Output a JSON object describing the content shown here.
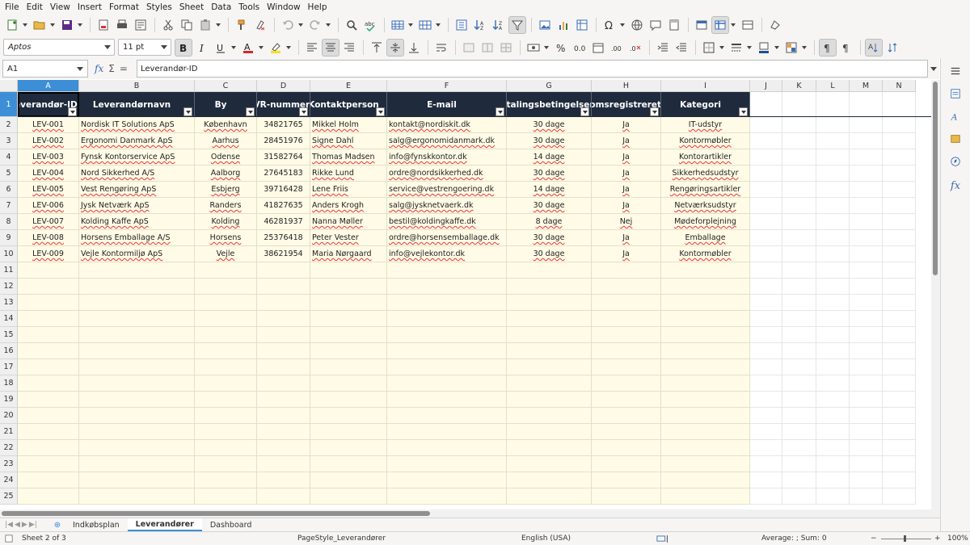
{
  "menu": [
    "File",
    "Edit",
    "View",
    "Insert",
    "Format",
    "Styles",
    "Sheet",
    "Data",
    "Tools",
    "Window",
    "Help"
  ],
  "format": {
    "font_name": "Aptos",
    "font_size": "11 pt"
  },
  "formula_bar": {
    "cell_ref": "A1",
    "content": "Leverandør-ID"
  },
  "columns": [
    "A",
    "B",
    "C",
    "D",
    "E",
    "F",
    "G",
    "H",
    "I",
    "J",
    "K",
    "L",
    "M",
    "N"
  ],
  "headers": [
    "Leverandør-ID",
    "Leverandørnavn",
    "By",
    "CVR-nummer",
    "Kontaktperson",
    "E-mail",
    "Betalingsbetingelser",
    "Momsregistreret",
    "Kategori"
  ],
  "rows": [
    [
      "LEV-001",
      "Nordisk IT Solutions ApS",
      "København",
      "34821765",
      "Mikkel Holm",
      "kontakt@nordiskit.dk",
      "30 dage",
      "Ja",
      "IT-udstyr"
    ],
    [
      "LEV-002",
      "Ergonomi Danmark ApS",
      "Aarhus",
      "28451976",
      "Signe Dahl",
      "salg@ergonomidanmark.dk",
      "30 dage",
      "Ja",
      "Kontormøbler"
    ],
    [
      "LEV-003",
      "Fynsk Kontorservice ApS",
      "Odense",
      "31582764",
      "Thomas Madsen",
      "info@fynskkontor.dk",
      "14 dage",
      "Ja",
      "Kontorartikler"
    ],
    [
      "LEV-004",
      "Nord Sikkerhed A/S",
      "Aalborg",
      "27645183",
      "Rikke Lund",
      "ordre@nordsikkerhed.dk",
      "30 dage",
      "Ja",
      "Sikkerhedsudstyr"
    ],
    [
      "LEV-005",
      "Vest Rengøring ApS",
      "Esbjerg",
      "39716428",
      "Lene Friis",
      "service@vestrengoering.dk",
      "14 dage",
      "Ja",
      "Rengøringsartikler"
    ],
    [
      "LEV-006",
      "Jysk Netværk ApS",
      "Randers",
      "41827635",
      "Anders Krogh",
      "salg@jysknetvaerk.dk",
      "30 dage",
      "Ja",
      "Netværksudstyr"
    ],
    [
      "LEV-007",
      "Kolding Kaffe ApS",
      "Kolding",
      "46281937",
      "Nanna Møller",
      "bestil@koldingkaffe.dk",
      "8 dage",
      "Nej",
      "Mødeforplejning"
    ],
    [
      "LEV-008",
      "Horsens Emballage A/S",
      "Horsens",
      "25376418",
      "Peter Vester",
      "ordre@horsensemballage.dk",
      "30 dage",
      "Ja",
      "Emballage"
    ],
    [
      "LEV-009",
      "Vejle Kontormiljø ApS",
      "Vejle",
      "38621954",
      "Maria Nørgaard",
      "info@vejlekontor.dk",
      "30 dage",
      "Ja",
      "Kontormøbler"
    ]
  ],
  "row_numbers": [
    "1",
    "2",
    "3",
    "4",
    "5",
    "6",
    "7",
    "8",
    "9",
    "10",
    "11",
    "12",
    "13",
    "14",
    "15",
    "16",
    "17",
    "18",
    "19",
    "20",
    "21",
    "22",
    "23",
    "24",
    "25"
  ],
  "sheet_tabs": [
    "Indkøbsplan",
    "Leverandører",
    "Dashboard"
  ],
  "active_tab": "Leverandører",
  "status": {
    "sheet": "Sheet 2 of 3",
    "page_style": "PageStyle_Leverandører",
    "language": "English (USA)",
    "summary": "Average: ; Sum: 0",
    "zoom": "100%"
  },
  "colors": {
    "header_bg": "#1f2a3c",
    "cell_bg": "#fffbe6",
    "selection": "#3c8fd6"
  }
}
